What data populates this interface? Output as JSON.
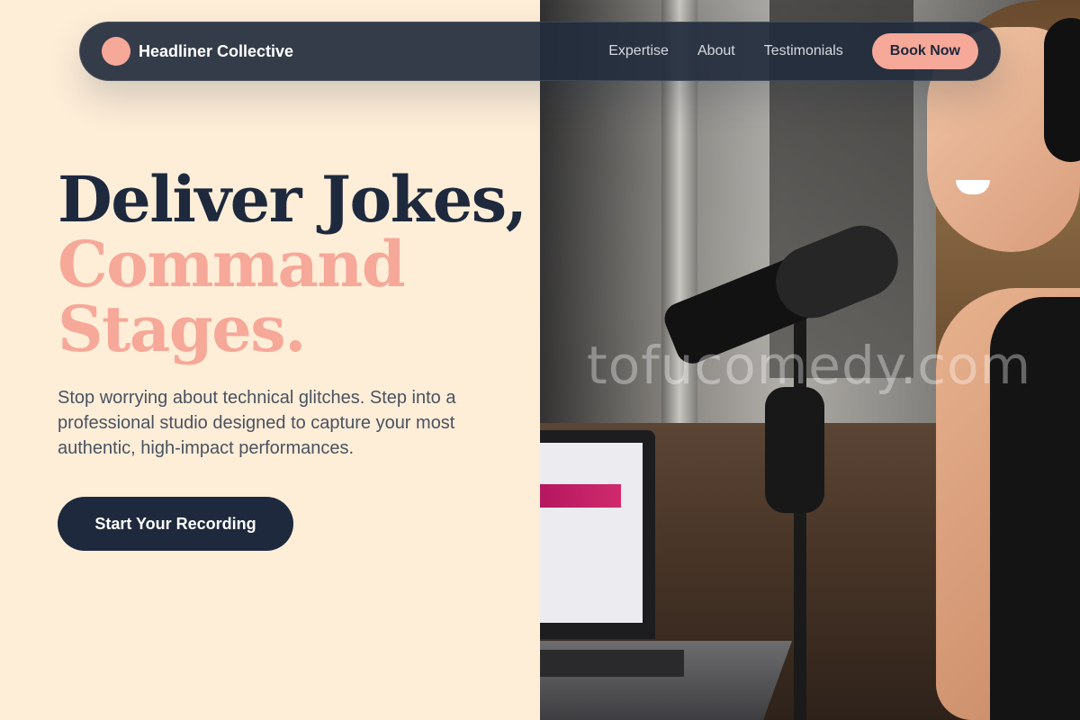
{
  "nav": {
    "brand": "Headliner Collective",
    "links": [
      "Expertise",
      "About",
      "Testimonials"
    ],
    "cta": "Book Now"
  },
  "hero": {
    "headline_line1": "Deliver Jokes,",
    "headline_line2": "Command",
    "headline_line3": "Stages.",
    "subtext": "Stop worrying about technical glitches. Step into a professional studio designed to capture your most authentic, high-impact performances.",
    "cta": "Start Your Recording"
  },
  "image": {
    "watermark": "tofucomedy.com"
  },
  "colors": {
    "background": "#feeed8",
    "navy": "#1e293d",
    "accent": "#f6a899"
  }
}
